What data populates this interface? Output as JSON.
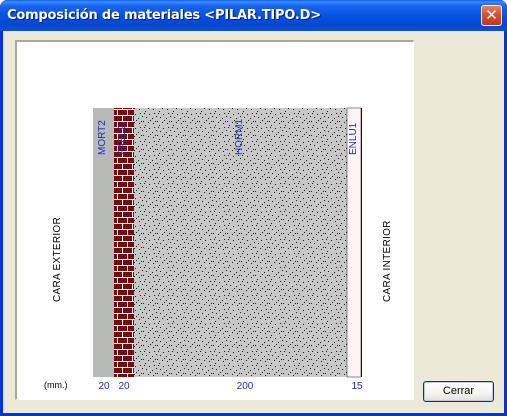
{
  "window": {
    "title": "Composición de materiales <PILAR.TIPO.D>",
    "close_glyph": "✕"
  },
  "diagram": {
    "side_exterior": "CARA EXTERIOR",
    "side_interior": "CARA INTERIOR",
    "units_label": "(mm.)",
    "layers": [
      {
        "code": "MORT2",
        "thickness": "20",
        "fill": "#b7bab7",
        "pattern": "plain"
      },
      {
        "code": "FABL9",
        "thickness": "20",
        "fill": "#7a0a0a",
        "pattern": "brick"
      },
      {
        "code": "HORM1",
        "thickness": "200",
        "fill": "#c8c8c8",
        "pattern": "dots"
      },
      {
        "code": "ENLU1",
        "thickness": "15",
        "fill": "#fcf4f4",
        "pattern": "plain"
      }
    ]
  },
  "buttons": {
    "close_label": "Cerrar"
  }
}
